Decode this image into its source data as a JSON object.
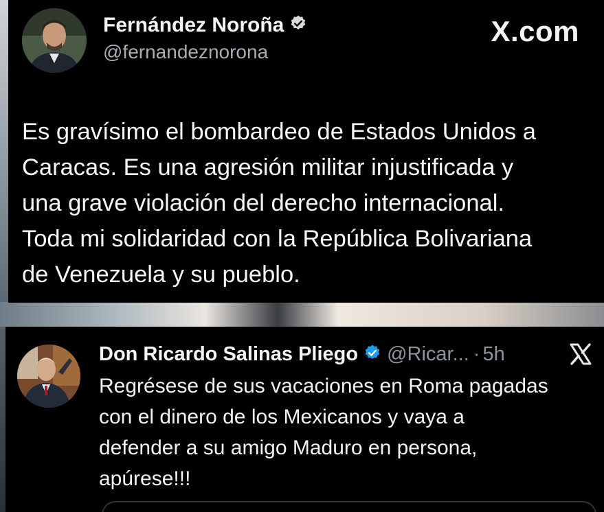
{
  "colors": {
    "card_bg": "#000000",
    "verified_blue": "#1d9bf0",
    "muted_text": "#a7aeb4"
  },
  "post": {
    "author_name": "Fernández Noroña",
    "handle": "@fernandeznorona",
    "verified_icon": "verified-badge-icon",
    "site_label": "X.com",
    "text_lines": [
      "Es gravísimo el bombardeo de Estados Unidos a",
      "Caracas. Es una agresión militar injustificada y",
      "una grave violación del derecho internacional.",
      "Toda mi solidaridad con la República Bolivariana",
      "de Venezuela y su pueblo."
    ]
  },
  "reply": {
    "author_name": "Don Ricardo Salinas Pliego",
    "handle": "@Ricar...",
    "separator": "·",
    "time": "5h",
    "platform_icon": "x-logo-icon",
    "text_lines": [
      "Regrésese de sus vacaciones en Roma pagadas",
      "con el dinero de los Mexicanos y vaya a",
      "defender a su amigo Maduro en persona,",
      "apúrese!!!"
    ]
  }
}
